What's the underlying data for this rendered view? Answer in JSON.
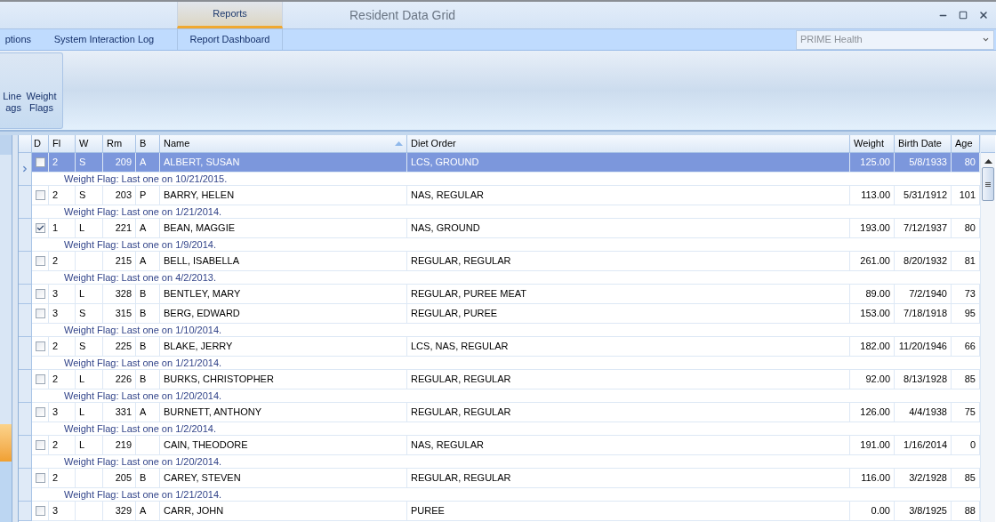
{
  "window": {
    "title": "Resident Data Grid",
    "context_tab": "Reports",
    "controls": [
      {
        "kind": "minimize"
      },
      {
        "kind": "maximize"
      },
      {
        "kind": "close"
      }
    ]
  },
  "tabs": [
    {
      "label": "ptions",
      "selected": false
    },
    {
      "label": "System Interaction Log",
      "selected": false
    },
    {
      "label": "Report Dashboard",
      "selected": false
    }
  ],
  "facility": {
    "value": "PRIME Health"
  },
  "ribbon": {
    "buttons": [
      {
        "lines": [
          "Line",
          "ags"
        ]
      },
      {
        "lines": [
          "Weight",
          "Flags"
        ]
      }
    ]
  },
  "table": {
    "checkbox_column": "D",
    "columns": [
      "Fl",
      "W",
      "Rm",
      "B",
      "Name",
      "Diet Order",
      "Weight",
      "Birth Date",
      "Age"
    ],
    "rows": [
      {
        "selected": true,
        "checked": false,
        "cells": [
          "2",
          "S",
          "209",
          "A",
          "ALBERT, SUSAN",
          "LCS, GROUND",
          "125.00",
          "5/8/1933",
          "80"
        ],
        "flag": "Weight Flag: Last one on 10/21/2015."
      },
      {
        "selected": false,
        "checked": false,
        "cells": [
          "2",
          "S",
          "203",
          "P",
          "BARRY, HELEN",
          "NAS, REGULAR",
          "113.00",
          "5/31/1912",
          "101"
        ],
        "flag": "Weight Flag: Last one on 1/21/2014."
      },
      {
        "selected": false,
        "checked": true,
        "cells": [
          "1",
          "L",
          "221",
          "A",
          "BEAN, MAGGIE",
          "NAS, GROUND",
          "193.00",
          "7/12/1937",
          "80"
        ],
        "flag": "Weight Flag: Last one on 1/9/2014."
      },
      {
        "selected": false,
        "checked": false,
        "cells": [
          "2",
          "",
          "215",
          "A",
          "BELL, ISABELLA",
          "REGULAR, REGULAR",
          "261.00",
          "8/20/1932",
          "81"
        ],
        "flag": "Weight Flag: Last one on 4/2/2013."
      },
      {
        "selected": false,
        "checked": false,
        "cells": [
          "3",
          "L",
          "328",
          "B",
          "BENTLEY, MARY",
          "REGULAR, PUREE MEAT",
          "89.00",
          "7/2/1940",
          "73"
        ]
      },
      {
        "selected": false,
        "checked": false,
        "cells": [
          "3",
          "S",
          "315",
          "B",
          "BERG, EDWARD",
          "REGULAR, PUREE",
          "153.00",
          "7/18/1918",
          "95"
        ],
        "flag": "Weight Flag: Last one on 1/10/2014."
      },
      {
        "selected": false,
        "checked": false,
        "cells": [
          "2",
          "S",
          "225",
          "B",
          "BLAKE, JERRY",
          "LCS, NAS, REGULAR",
          "182.00",
          "11/20/1946",
          "66"
        ],
        "flag": "Weight Flag: Last one on 1/21/2014."
      },
      {
        "selected": false,
        "checked": false,
        "cells": [
          "2",
          "L",
          "226",
          "B",
          "BURKS, CHRISTOPHER",
          "REGULAR, REGULAR",
          "92.00",
          "8/13/1928",
          "85"
        ],
        "flag": "Weight Flag: Last one on 1/20/2014."
      },
      {
        "selected": false,
        "checked": false,
        "cells": [
          "3",
          "L",
          "331",
          "A",
          "BURNETT, ANTHONY",
          "REGULAR, REGULAR",
          "126.00",
          "4/4/1938",
          "75"
        ],
        "flag": "Weight Flag: Last one on 1/2/2014."
      },
      {
        "selected": false,
        "checked": false,
        "cells": [
          "2",
          "L",
          "219",
          "",
          "CAIN, THEODORE",
          "NAS, REGULAR",
          "191.00",
          "1/16/2014",
          "0"
        ],
        "flag": "Weight Flag: Last one on 1/20/2014."
      },
      {
        "selected": false,
        "checked": false,
        "cells": [
          "2",
          "",
          "205",
          "B",
          "CAREY, STEVEN",
          "REGULAR, REGULAR",
          "116.00",
          "3/2/1928",
          "85"
        ],
        "flag": "Weight Flag: Last one on 1/21/2014."
      },
      {
        "selected": false,
        "checked": false,
        "cells": [
          "3",
          "",
          "329",
          "A",
          "CARR, JOHN",
          "PUREE",
          "0.00",
          "3/8/1925",
          "88"
        ]
      }
    ]
  }
}
